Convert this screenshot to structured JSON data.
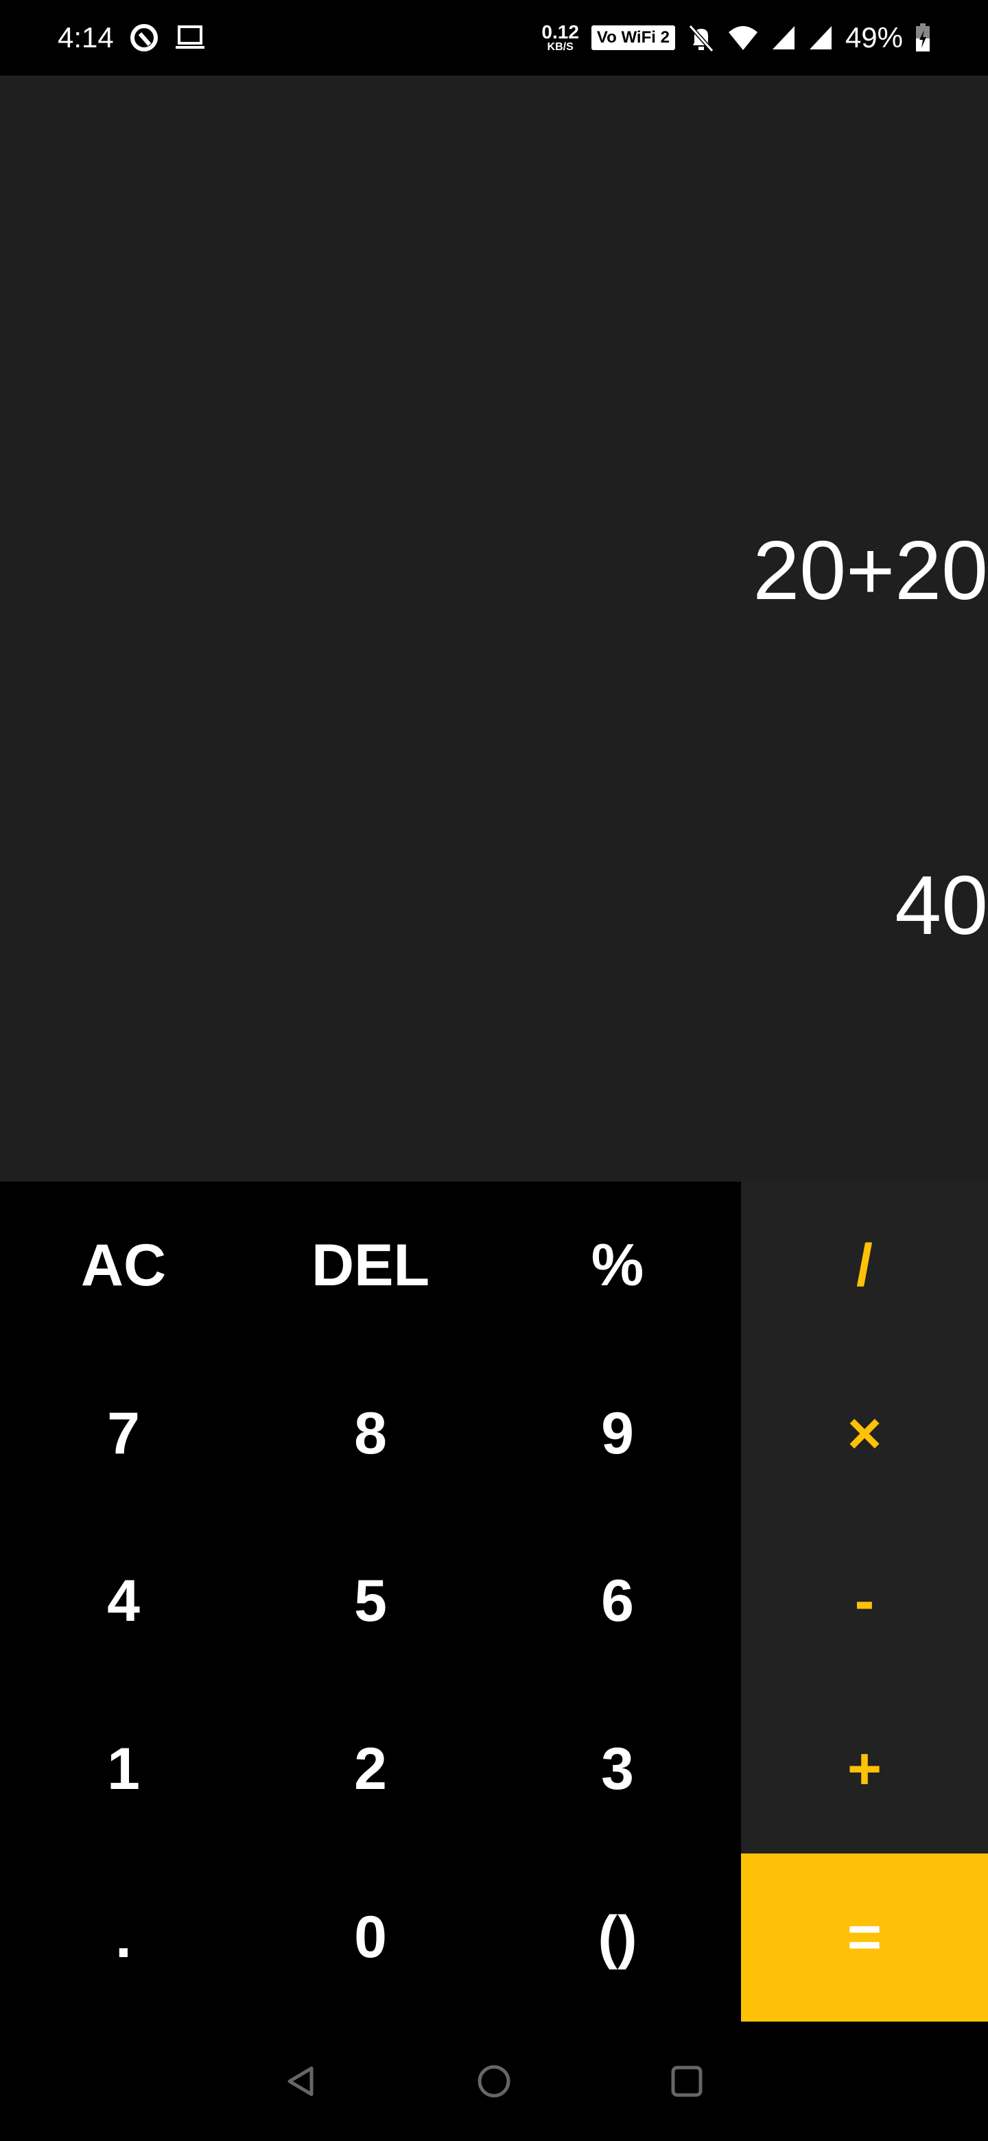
{
  "status_bar": {
    "time": "4:14",
    "net_speed": "0.12",
    "net_unit": "KB/S",
    "vowifi": "Vo WiFi 2",
    "battery": "49%"
  },
  "display": {
    "expression": "20+20",
    "result": "40"
  },
  "keys": {
    "row1": [
      "AC",
      "DEL",
      "%",
      "/"
    ],
    "row2": [
      "7",
      "8",
      "9",
      "×"
    ],
    "row3": [
      "4",
      "5",
      "6",
      "-"
    ],
    "row4": [
      "1",
      "2",
      "3",
      "+"
    ],
    "row5": [
      ".",
      "0",
      "()",
      "="
    ]
  },
  "colors": {
    "accent": "#ffc107",
    "display_bg": "#1f1f1f",
    "operator_bg": "#222222"
  }
}
